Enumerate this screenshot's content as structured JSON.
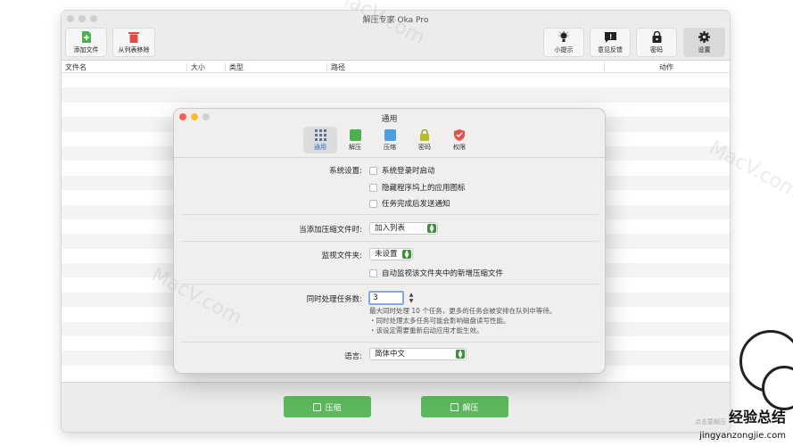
{
  "window": {
    "title": "解压专家 Oka Pro"
  },
  "toolbar": {
    "add_file_label": "添加文件",
    "remove_label": "从列表移除",
    "tips_label": "小提示",
    "feedback_label": "意见反馈",
    "password_label": "密码",
    "settings_label": "设置"
  },
  "columns": {
    "name": "文件名",
    "size": "大小",
    "type": "类型",
    "path": "路径",
    "action": "动作"
  },
  "bottom": {
    "compress_label": "压缩",
    "extract_label": "解压",
    "hint": "点击要解压"
  },
  "dialog": {
    "title": "通用",
    "tabs": [
      {
        "label": "通用",
        "icon": "grid-icon"
      },
      {
        "label": "解压",
        "icon": "extract-icon"
      },
      {
        "label": "压缩",
        "icon": "compress-icon"
      },
      {
        "label": "密码",
        "icon": "lock-icon"
      },
      {
        "label": "权限",
        "icon": "shield-icon"
      }
    ],
    "system_label": "系统设置:",
    "system_opts": [
      "系统登录时启动",
      "隐藏程序坞上的应用图标",
      "任务完成后发送通知"
    ],
    "on_add_label": "当添加压缩文件时:",
    "on_add_value": "加入列表",
    "watch_label": "监视文件夹:",
    "watch_value": "未设置",
    "watch_opt": "自动监视该文件夹中的新增压缩文件",
    "concurrent_label": "同时处理任务数:",
    "concurrent_value": "3",
    "concurrent_desc": [
      "最大同时处理 10 个任务，更多的任务会被安排在队列中等待。",
      "・同时处理太多任务可能会影响磁盘读写性能。",
      "・该设定需要重新启动应用才能生效。"
    ],
    "language_label": "语言:",
    "language_value": "简体中文"
  },
  "watermarks": {
    "macv": "MacV.com",
    "logo": "经验总结",
    "url": "jingyanzongjie.com"
  },
  "colors": {
    "green": "#5cb85c",
    "accent": "#2a6ed8"
  }
}
